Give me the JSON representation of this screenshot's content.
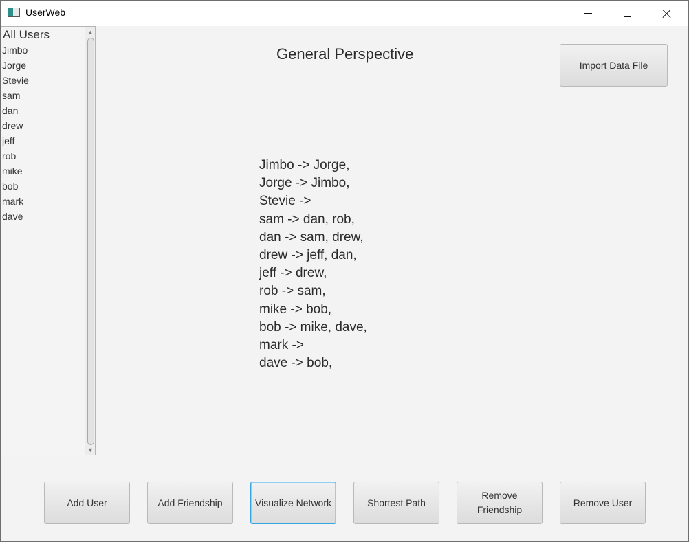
{
  "window": {
    "title": "UserWeb",
    "controls": {
      "minimize": "",
      "maximize": "",
      "close": ""
    }
  },
  "users": {
    "header": "All Users",
    "items": [
      "Jimbo",
      "Jorge",
      "Stevie",
      "sam",
      "dan",
      "drew",
      "jeff",
      "rob",
      "mike",
      "bob",
      "mark",
      "dave"
    ]
  },
  "main": {
    "title": "General Perspective",
    "import_label": "Import Data File",
    "relations": [
      "Jimbo -> Jorge,",
      "Jorge -> Jimbo,",
      "Stevie ->",
      "sam -> dan, rob,",
      "dan -> sam, drew,",
      "drew -> jeff, dan,",
      "jeff -> drew,",
      "rob -> sam,",
      "mike -> bob,",
      "bob -> mike, dave,",
      "mark ->",
      "dave -> bob,"
    ]
  },
  "actions": {
    "add_user": "Add User",
    "add_friendship": "Add Friendship",
    "visualize_network": "Visualize Network",
    "shortest_path": "Shortest Path",
    "remove_friendship": "Remove Friendship",
    "remove_user": "Remove User"
  },
  "colors": {
    "window_bg": "#f3f3f3",
    "focus_border": "#39a5de",
    "text": "#333333"
  }
}
